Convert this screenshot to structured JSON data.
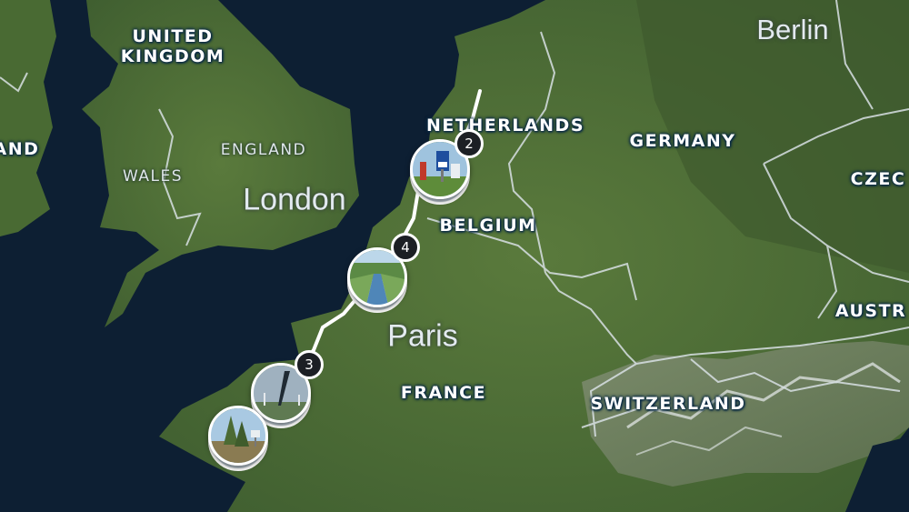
{
  "map": {
    "country_labels": {
      "united_kingdom": "UNITED\nKINGDOM",
      "ireland": "AND",
      "netherlands": "NETHERLANDS",
      "germany": "GERMANY",
      "belgium": "BELGIUM",
      "france": "FRANCE",
      "switzerland": "SWITZERLAND",
      "czechia": "CZEC",
      "austria": "AUSTR"
    },
    "region_labels": {
      "england": "ENGLAND",
      "wales": "WALES"
    },
    "city_labels": {
      "london": "London",
      "paris": "Paris",
      "berlin": "Berlin"
    },
    "route_markers": [
      {
        "id": "netherlands-stop",
        "count": "2",
        "icon": "sign-photo-icon"
      },
      {
        "id": "north-france-stop",
        "count": "4",
        "icon": "canal-photo-icon"
      },
      {
        "id": "normandy-stop",
        "count": "3",
        "icon": "storm-photo-icon"
      },
      {
        "id": "brittany-stop",
        "count": "",
        "icon": "forest-photo-icon"
      }
    ],
    "colors": {
      "sea": "#0d1f33",
      "land": "#4a6b36",
      "route": "#ffffff",
      "badge": "#1c1f24"
    }
  }
}
